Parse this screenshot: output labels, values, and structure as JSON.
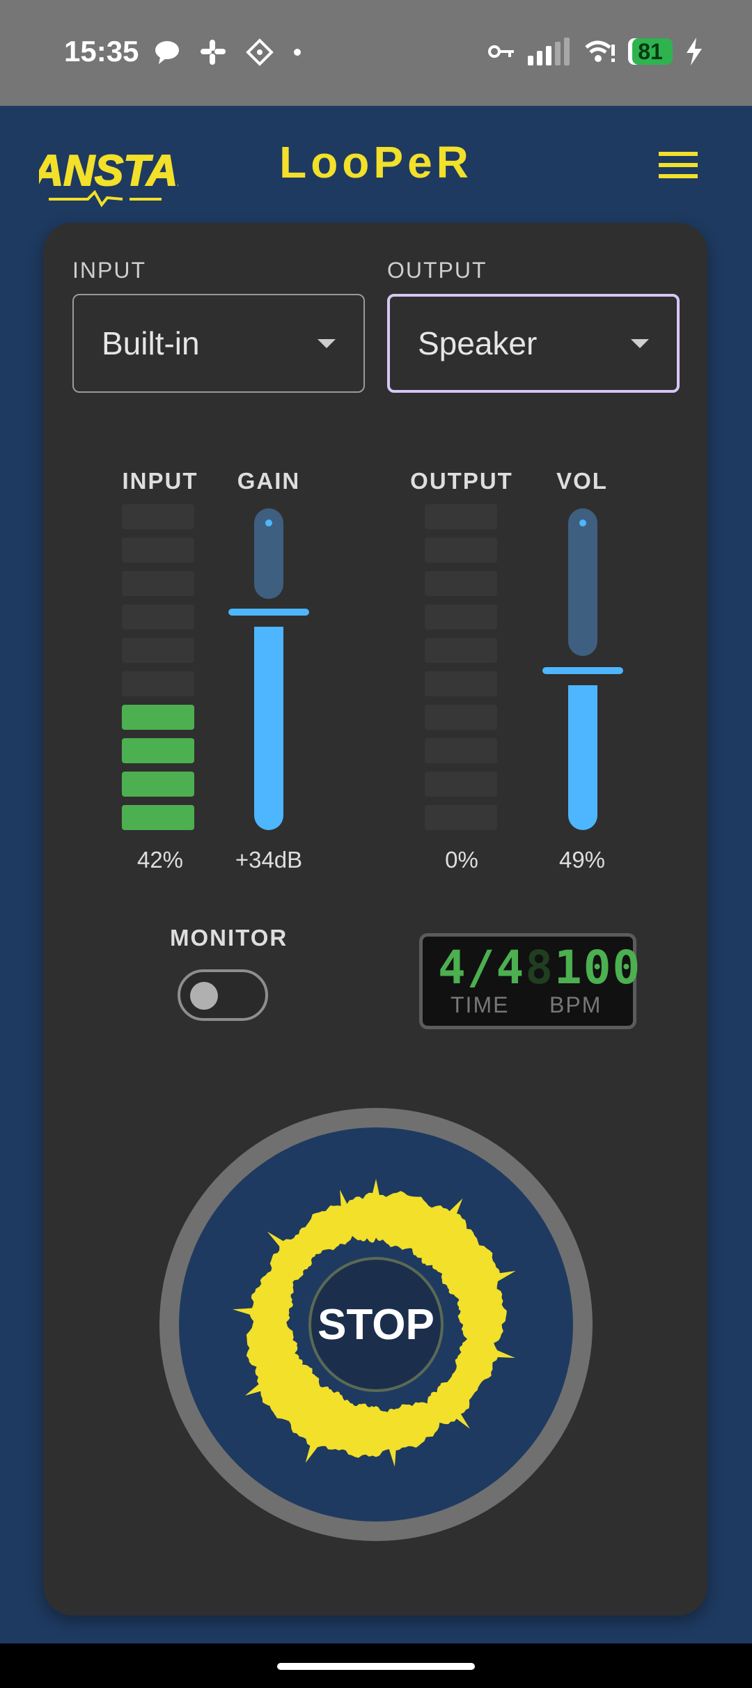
{
  "status_bar": {
    "time": "15:35",
    "battery": "81",
    "icons_left": [
      "chat-bubble-icon",
      "slack-icon",
      "app-grid-icon",
      "dot-icon"
    ],
    "icons_right": [
      "key-icon",
      "signal-icon",
      "wifi-icon",
      "battery-icon",
      "charging-icon"
    ]
  },
  "app": {
    "title": "LooPeR",
    "logo_text": "FANSTAR",
    "brand_color": "#f2e02a"
  },
  "input_select": {
    "label": "INPUT",
    "value": "Built-in"
  },
  "output_select": {
    "label": "OUTPUT",
    "value": "Speaker"
  },
  "meters": {
    "input": {
      "label": "INPUT",
      "value": "42%",
      "level_segments": 4,
      "total_segments": 10
    },
    "gain": {
      "label": "GAIN",
      "value": "+34dB",
      "level": 0.68
    },
    "output": {
      "label": "OUTPUT",
      "value": "0%",
      "level_segments": 0,
      "total_segments": 10
    },
    "vol": {
      "label": "VOL",
      "value": "49%",
      "level": 0.49
    }
  },
  "monitor": {
    "label": "MONITOR",
    "on": false
  },
  "display": {
    "time_sig": "4/4",
    "bpm": "100",
    "time_caption": "TIME",
    "bpm_caption": "BPM"
  },
  "transport": {
    "button_label": "STOP"
  },
  "colors": {
    "background": "#1e3a60",
    "card": "#2f2f2f",
    "meter_on": "#4caf50",
    "slider": "#4db6ff",
    "waveform": "#f2e02a"
  }
}
